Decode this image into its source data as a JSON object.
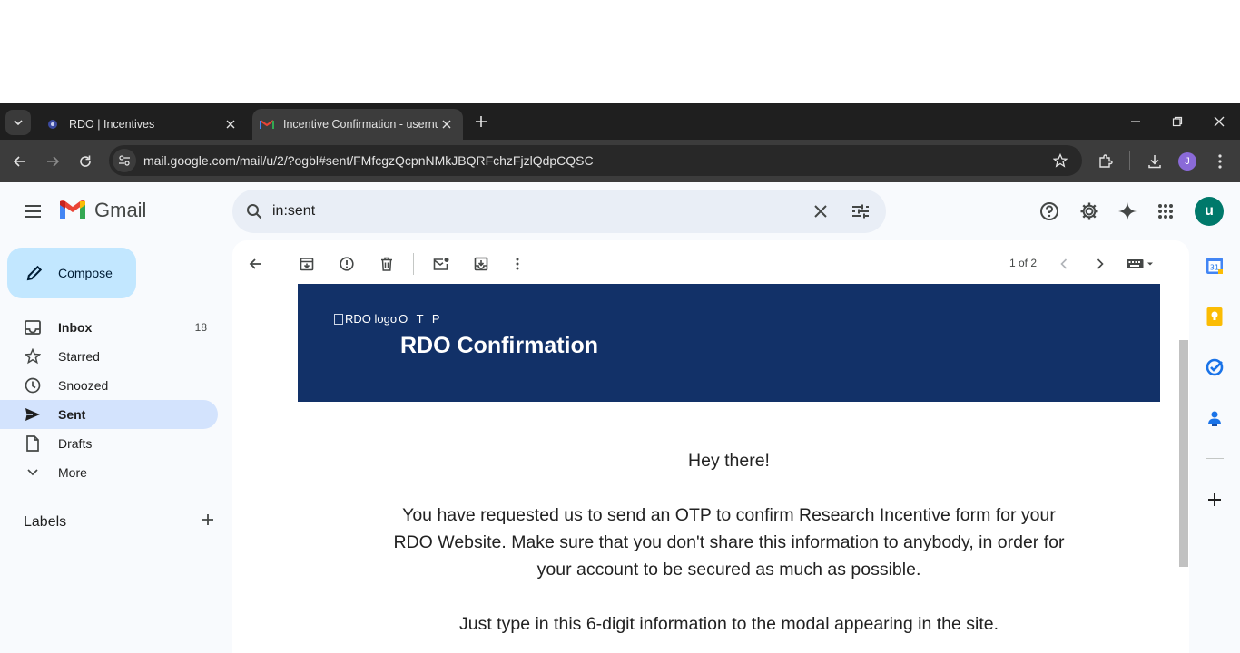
{
  "browser": {
    "tabs": [
      {
        "title": "RDO | Incentives",
        "active": false
      },
      {
        "title": "Incentive Confirmation - usernu",
        "active": true
      }
    ],
    "url": "mail.google.com/mail/u/2/?ogbl#sent/FMfcgzQcpnNMkJBQRFchzFjzlQdpCQSC",
    "profile_initial": "J"
  },
  "gmail": {
    "brand": "Gmail",
    "search_value": "in:sent",
    "avatar_initial": "u",
    "compose_label": "Compose",
    "nav": [
      {
        "label": "Inbox",
        "count": "18",
        "icon": "inbox-icon"
      },
      {
        "label": "Starred",
        "count": "",
        "icon": "star-icon"
      },
      {
        "label": "Snoozed",
        "count": "",
        "icon": "clock-icon"
      },
      {
        "label": "Sent",
        "count": "",
        "icon": "send-icon"
      },
      {
        "label": "Drafts",
        "count": "",
        "icon": "draft-icon"
      },
      {
        "label": "More",
        "count": "",
        "icon": "chevron-down-icon"
      }
    ],
    "labels_title": "Labels",
    "pager": "1 of 2"
  },
  "email": {
    "header_alt": "RDO logo",
    "header_otp": "O T P",
    "header_title": "RDO Confirmation",
    "greeting": "Hey there!",
    "paragraph1": "You have requested us to send an OTP to confirm Research Incentive form for your RDO Website. Make sure that you don't share this information to anybody, in order for your account to be secured as much as possible.",
    "paragraph2": "Just type in this 6-digit information to the modal appearing in the site."
  },
  "colors": {
    "email_header_bg": "#123168",
    "compose_bg": "#c2e7ff",
    "active_nav_bg": "#d3e3fd",
    "avatar_bg": "#00796b"
  }
}
